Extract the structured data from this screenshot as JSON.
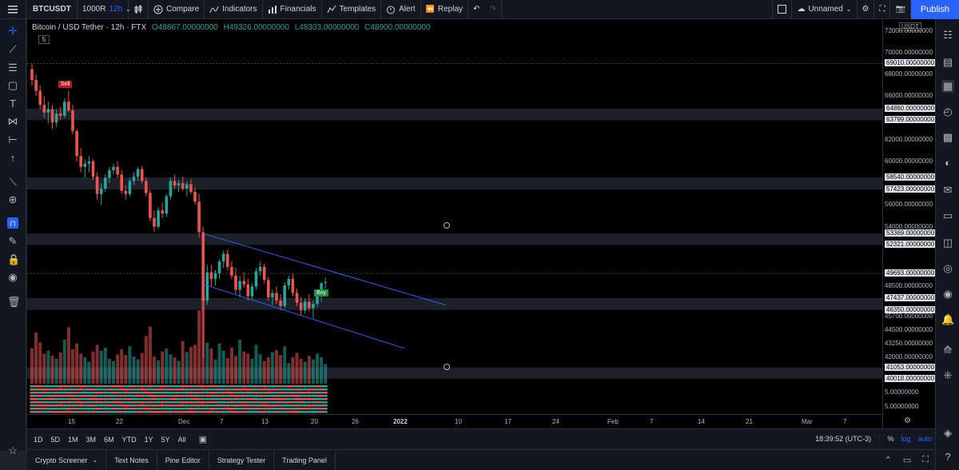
{
  "toolbar": {
    "menu_icon": "hamburger-icon",
    "symbol": "BTCUSDT",
    "chart_type_value": "1000R",
    "interval": "12h",
    "compare_label": "Compare",
    "indicators_label": "Indicators",
    "financials_label": "Financials",
    "templates_label": "Templates",
    "alert_label": "Alert",
    "replay_label": "Replay",
    "layout_name": "Unnamed",
    "publish_label": "Publish"
  },
  "legend": {
    "title": "Bitcoin / USD Tether · 12h · FTX",
    "open": "O48867.00000000",
    "high": "H49326.00000000",
    "low": "L48303.00000000",
    "close": "C48900.00000000",
    "indicator_count": "5"
  },
  "markers": {
    "sell": "Sell",
    "buy": "Buy"
  },
  "price_axis": {
    "currency": "USDT",
    "ticks": [
      {
        "label": "72000.00000000",
        "price": 72000
      },
      {
        "label": "70000.00000000",
        "price": 70000
      },
      {
        "label": "68000.00000000",
        "price": 68000
      },
      {
        "label": "66000.00000000",
        "price": 66000
      },
      {
        "label": "62000.00000000",
        "price": 62000
      },
      {
        "label": "60000.00000000",
        "price": 60000
      },
      {
        "label": "56000.00000000",
        "price": 56000
      },
      {
        "label": "54000.00000000",
        "price": 54000
      },
      {
        "label": "48500.00000000",
        "price": 48500
      },
      {
        "label": "45700.00000000",
        "price": 45700
      },
      {
        "label": "44500.00000000",
        "price": 44500
      },
      {
        "label": "43250.00000000",
        "price": 43250
      },
      {
        "label": "42000.00000000",
        "price": 42000
      }
    ],
    "levels": [
      {
        "label": "69010.00000000",
        "price": 69010
      },
      {
        "label": "64860.00000000",
        "price": 64860
      },
      {
        "label": "63799.00000000",
        "price": 63799
      },
      {
        "label": "58540.00000000",
        "price": 58540
      },
      {
        "label": "57423.00000000",
        "price": 57423
      },
      {
        "label": "53369.00000000",
        "price": 53369
      },
      {
        "label": "52321.00000000",
        "price": 52321
      },
      {
        "label": "49693.00000000",
        "price": 49693
      },
      {
        "label": "47437.00000000",
        "price": 47437
      },
      {
        "label": "46350.00000000",
        "price": 46350
      },
      {
        "label": "41053.00000000",
        "price": 41053
      },
      {
        "label": "40018.00000000",
        "price": 40018
      }
    ],
    "sub_ticks": [
      "5.00000000",
      "5.00000000"
    ]
  },
  "time_axis": {
    "labels": [
      "15",
      "22",
      "Dec",
      "7",
      "13",
      "20",
      "26",
      "2022",
      "10",
      "17",
      "24",
      "Feb",
      "7",
      "14",
      "21",
      "Mar",
      "7"
    ]
  },
  "range_bar": {
    "ranges": [
      "1D",
      "5D",
      "1M",
      "3M",
      "6M",
      "YTD",
      "1Y",
      "5Y",
      "All"
    ],
    "clock": "18:39:52 (UTC-3)",
    "percent": "%",
    "log": "log",
    "auto": "auto"
  },
  "bottom_tabs": [
    "Crypto Screener",
    "Text Notes",
    "Pine Editor",
    "Strategy Tester",
    "Trading Panel"
  ],
  "colors": {
    "up": "#26a69a",
    "down": "#ef5350",
    "accent": "#2962ff",
    "zone": "#2a2e39"
  },
  "chart_data": {
    "type": "candlestick",
    "title": "Bitcoin / USD Tether",
    "interval": "12h",
    "exchange": "FTX",
    "ylim": [
      40000,
      72500
    ],
    "candles": [
      [
        68500,
        69000,
        67000,
        67500
      ],
      [
        67500,
        68000,
        66000,
        66500
      ],
      [
        66500,
        67000,
        64800,
        65200
      ],
      [
        65200,
        66000,
        64000,
        64500
      ],
      [
        64500,
        65500,
        63500,
        64800
      ],
      [
        64800,
        65200,
        63000,
        63600
      ],
      [
        63600,
        64800,
        63200,
        64400
      ],
      [
        64400,
        65000,
        63800,
        64200
      ],
      [
        64200,
        65800,
        64000,
        65500
      ],
      [
        65500,
        66500,
        64500,
        64700
      ],
      [
        64700,
        65200,
        62500,
        62800
      ],
      [
        62800,
        63000,
        60000,
        60500
      ],
      [
        60500,
        61200,
        59000,
        59500
      ],
      [
        59500,
        60200,
        58500,
        59800
      ],
      [
        59800,
        60500,
        59000,
        60000
      ],
      [
        60000,
        60200,
        58300,
        58600
      ],
      [
        58600,
        59000,
        56500,
        57000
      ],
      [
        57000,
        58000,
        56000,
        57500
      ],
      [
        57500,
        58800,
        57200,
        58500
      ],
      [
        58500,
        59500,
        58000,
        59200
      ],
      [
        59200,
        59800,
        58800,
        59500
      ],
      [
        59500,
        60000,
        58500,
        58800
      ],
      [
        58800,
        59200,
        57000,
        57300
      ],
      [
        57300,
        57800,
        56500,
        57000
      ],
      [
        57000,
        58500,
        56800,
        58200
      ],
      [
        58200,
        59000,
        57800,
        58600
      ],
      [
        58600,
        59500,
        58200,
        59300
      ],
      [
        59300,
        59600,
        58000,
        58200
      ],
      [
        58200,
        58500,
        56800,
        57100
      ],
      [
        57100,
        57400,
        54500,
        54800
      ],
      [
        54800,
        55500,
        53500,
        54000
      ],
      [
        54000,
        55800,
        53800,
        55500
      ],
      [
        55500,
        56200,
        54800,
        55200
      ],
      [
        55200,
        57000,
        54900,
        56800
      ],
      [
        56800,
        58500,
        56500,
        58200
      ],
      [
        58200,
        58800,
        57500,
        57800
      ],
      [
        57800,
        58300,
        57200,
        58000
      ],
      [
        58000,
        58600,
        57300,
        57500
      ],
      [
        57500,
        58200,
        56800,
        57900
      ],
      [
        57900,
        58400,
        57000,
        57200
      ],
      [
        57200,
        57600,
        56000,
        56300
      ],
      [
        56300,
        57000,
        53000,
        53500
      ],
      [
        53500,
        54000,
        42000,
        47200
      ],
      [
        47200,
        50500,
        46800,
        49800
      ],
      [
        49800,
        50500,
        48500,
        49200
      ],
      [
        49200,
        50000,
        48600,
        49700
      ],
      [
        49700,
        51000,
        49200,
        50800
      ],
      [
        50800,
        51800,
        50200,
        51500
      ],
      [
        51500,
        51900,
        50000,
        50300
      ],
      [
        50300,
        50800,
        49200,
        49500
      ],
      [
        49500,
        50200,
        47800,
        48200
      ],
      [
        48200,
        49500,
        47500,
        49000
      ],
      [
        49000,
        49800,
        48400,
        48700
      ],
      [
        48700,
        49200,
        47200,
        47600
      ],
      [
        47600,
        48800,
        47300,
        48500
      ],
      [
        48500,
        50200,
        48200,
        49900
      ],
      [
        49900,
        50800,
        49500,
        50300
      ],
      [
        50300,
        50600,
        48800,
        49100
      ],
      [
        49100,
        49400,
        47200,
        47500
      ],
      [
        47500,
        48200,
        46800,
        47900
      ],
      [
        47900,
        48500,
        46900,
        47200
      ],
      [
        47200,
        47800,
        46300,
        46700
      ],
      [
        46700,
        48900,
        46500,
        48600
      ],
      [
        48600,
        49500,
        48200,
        49200
      ],
      [
        49200,
        49700,
        47600,
        47900
      ],
      [
        47900,
        48300,
        46700,
        47000
      ],
      [
        47000,
        47500,
        45800,
        46300
      ],
      [
        46300,
        47400,
        46000,
        47100
      ],
      [
        47100,
        47800,
        46200,
        46500
      ],
      [
        46500,
        47200,
        45600,
        46900
      ],
      [
        46900,
        48200,
        46600,
        47900
      ],
      [
        47900,
        48900,
        47100,
        48800
      ],
      [
        48867,
        49326,
        48303,
        48900
      ]
    ],
    "volumes": [
      48,
      70,
      56,
      41,
      45,
      38,
      34,
      43,
      60,
      77,
      47,
      55,
      41,
      36,
      30,
      44,
      53,
      45,
      49,
      34,
      31,
      40,
      47,
      39,
      51,
      37,
      33,
      42,
      65,
      78,
      37,
      32,
      44,
      48,
      40,
      36,
      31,
      58,
      43,
      50,
      53,
      100,
      120,
      56,
      48,
      33,
      55,
      45,
      35,
      49,
      38,
      60,
      44,
      41,
      34,
      53,
      40,
      31,
      36,
      43,
      46,
      39,
      51,
      28,
      36,
      42,
      34,
      30,
      38,
      33,
      41,
      36,
      27
    ],
    "channel": {
      "upper": [
        [
          0,
          53369
        ],
        [
          32,
          46800
        ]
      ],
      "lower": [
        [
          0,
          48700
        ],
        [
          22,
          42800
        ]
      ]
    },
    "sell_marker_index": 8,
    "buy_marker_index": 70
  }
}
